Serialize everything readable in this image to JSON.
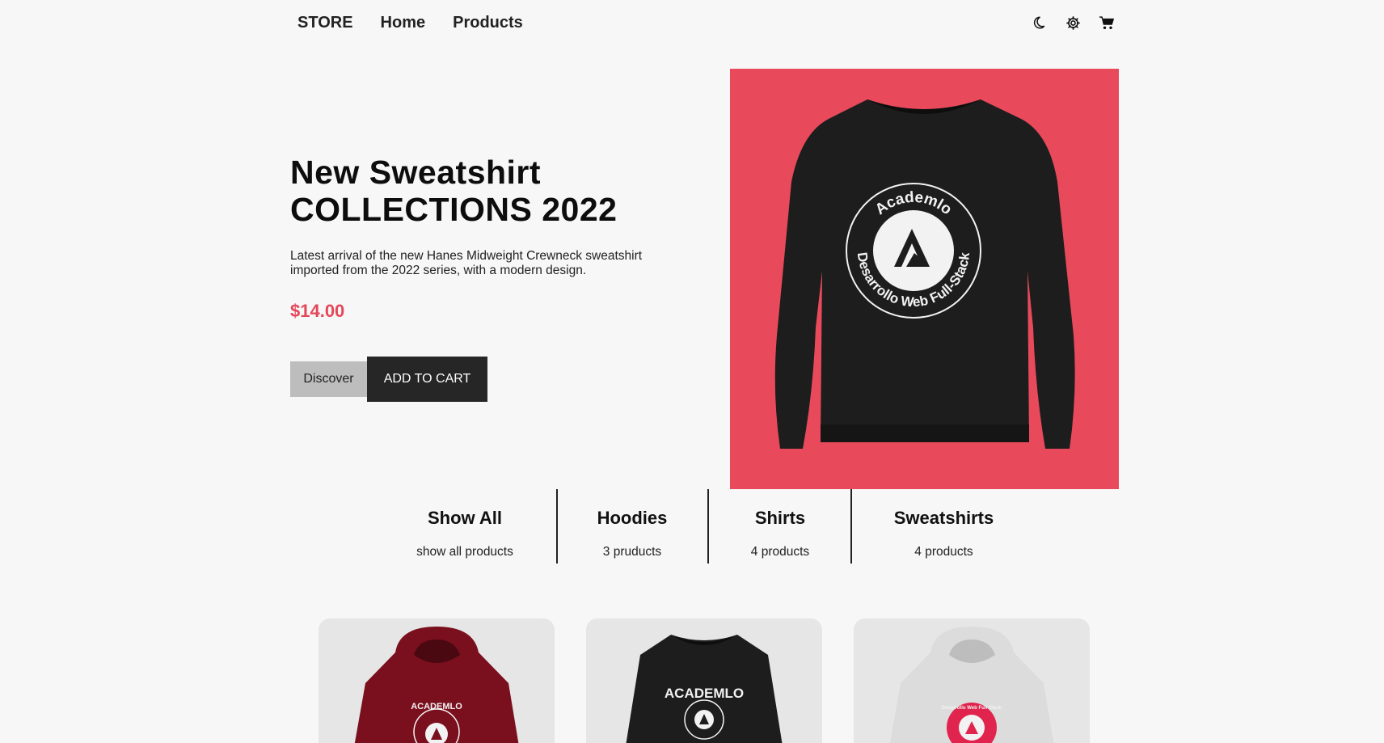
{
  "header": {
    "brand": "STORE",
    "nav": [
      "Home",
      "Products"
    ],
    "icons": [
      "moon-icon",
      "gear-icon",
      "cart-icon"
    ]
  },
  "hero": {
    "title_line1": "New Sweatshirt",
    "title_line2": "COLLECTIONS 2022",
    "description": "Latest arrival of the new Hanes Midweight Crewneck sweatshirt imported from the 2022 series, with a modern design.",
    "price": "$14.00",
    "discover_label": "Discover",
    "add_to_cart_label": "ADD TO CART",
    "image_badge_top": "Academlo",
    "image_badge_bottom": "Desarrollo Web Full-Stack"
  },
  "categories": [
    {
      "title": "Show All",
      "subtitle": "show all products"
    },
    {
      "title": "Hoodies",
      "subtitle": "3 pruducts"
    },
    {
      "title": "Shirts",
      "subtitle": "4 products"
    },
    {
      "title": "Sweatshirts",
      "subtitle": "4 products"
    }
  ],
  "products": [
    {
      "name": "maroon-hoodie",
      "print": "ACADEMLO"
    },
    {
      "name": "black-sweatshirt",
      "print": "ACADEMLO"
    },
    {
      "name": "grey-hoodie",
      "print": "Desarrollo Web Full-Stack"
    }
  ],
  "colors": {
    "accent": "#e5475a",
    "hero_bg": "#e84a5b",
    "dark_button": "#262626",
    "light_button": "#bdbdbd",
    "page_bg": "#f7f7f7"
  }
}
